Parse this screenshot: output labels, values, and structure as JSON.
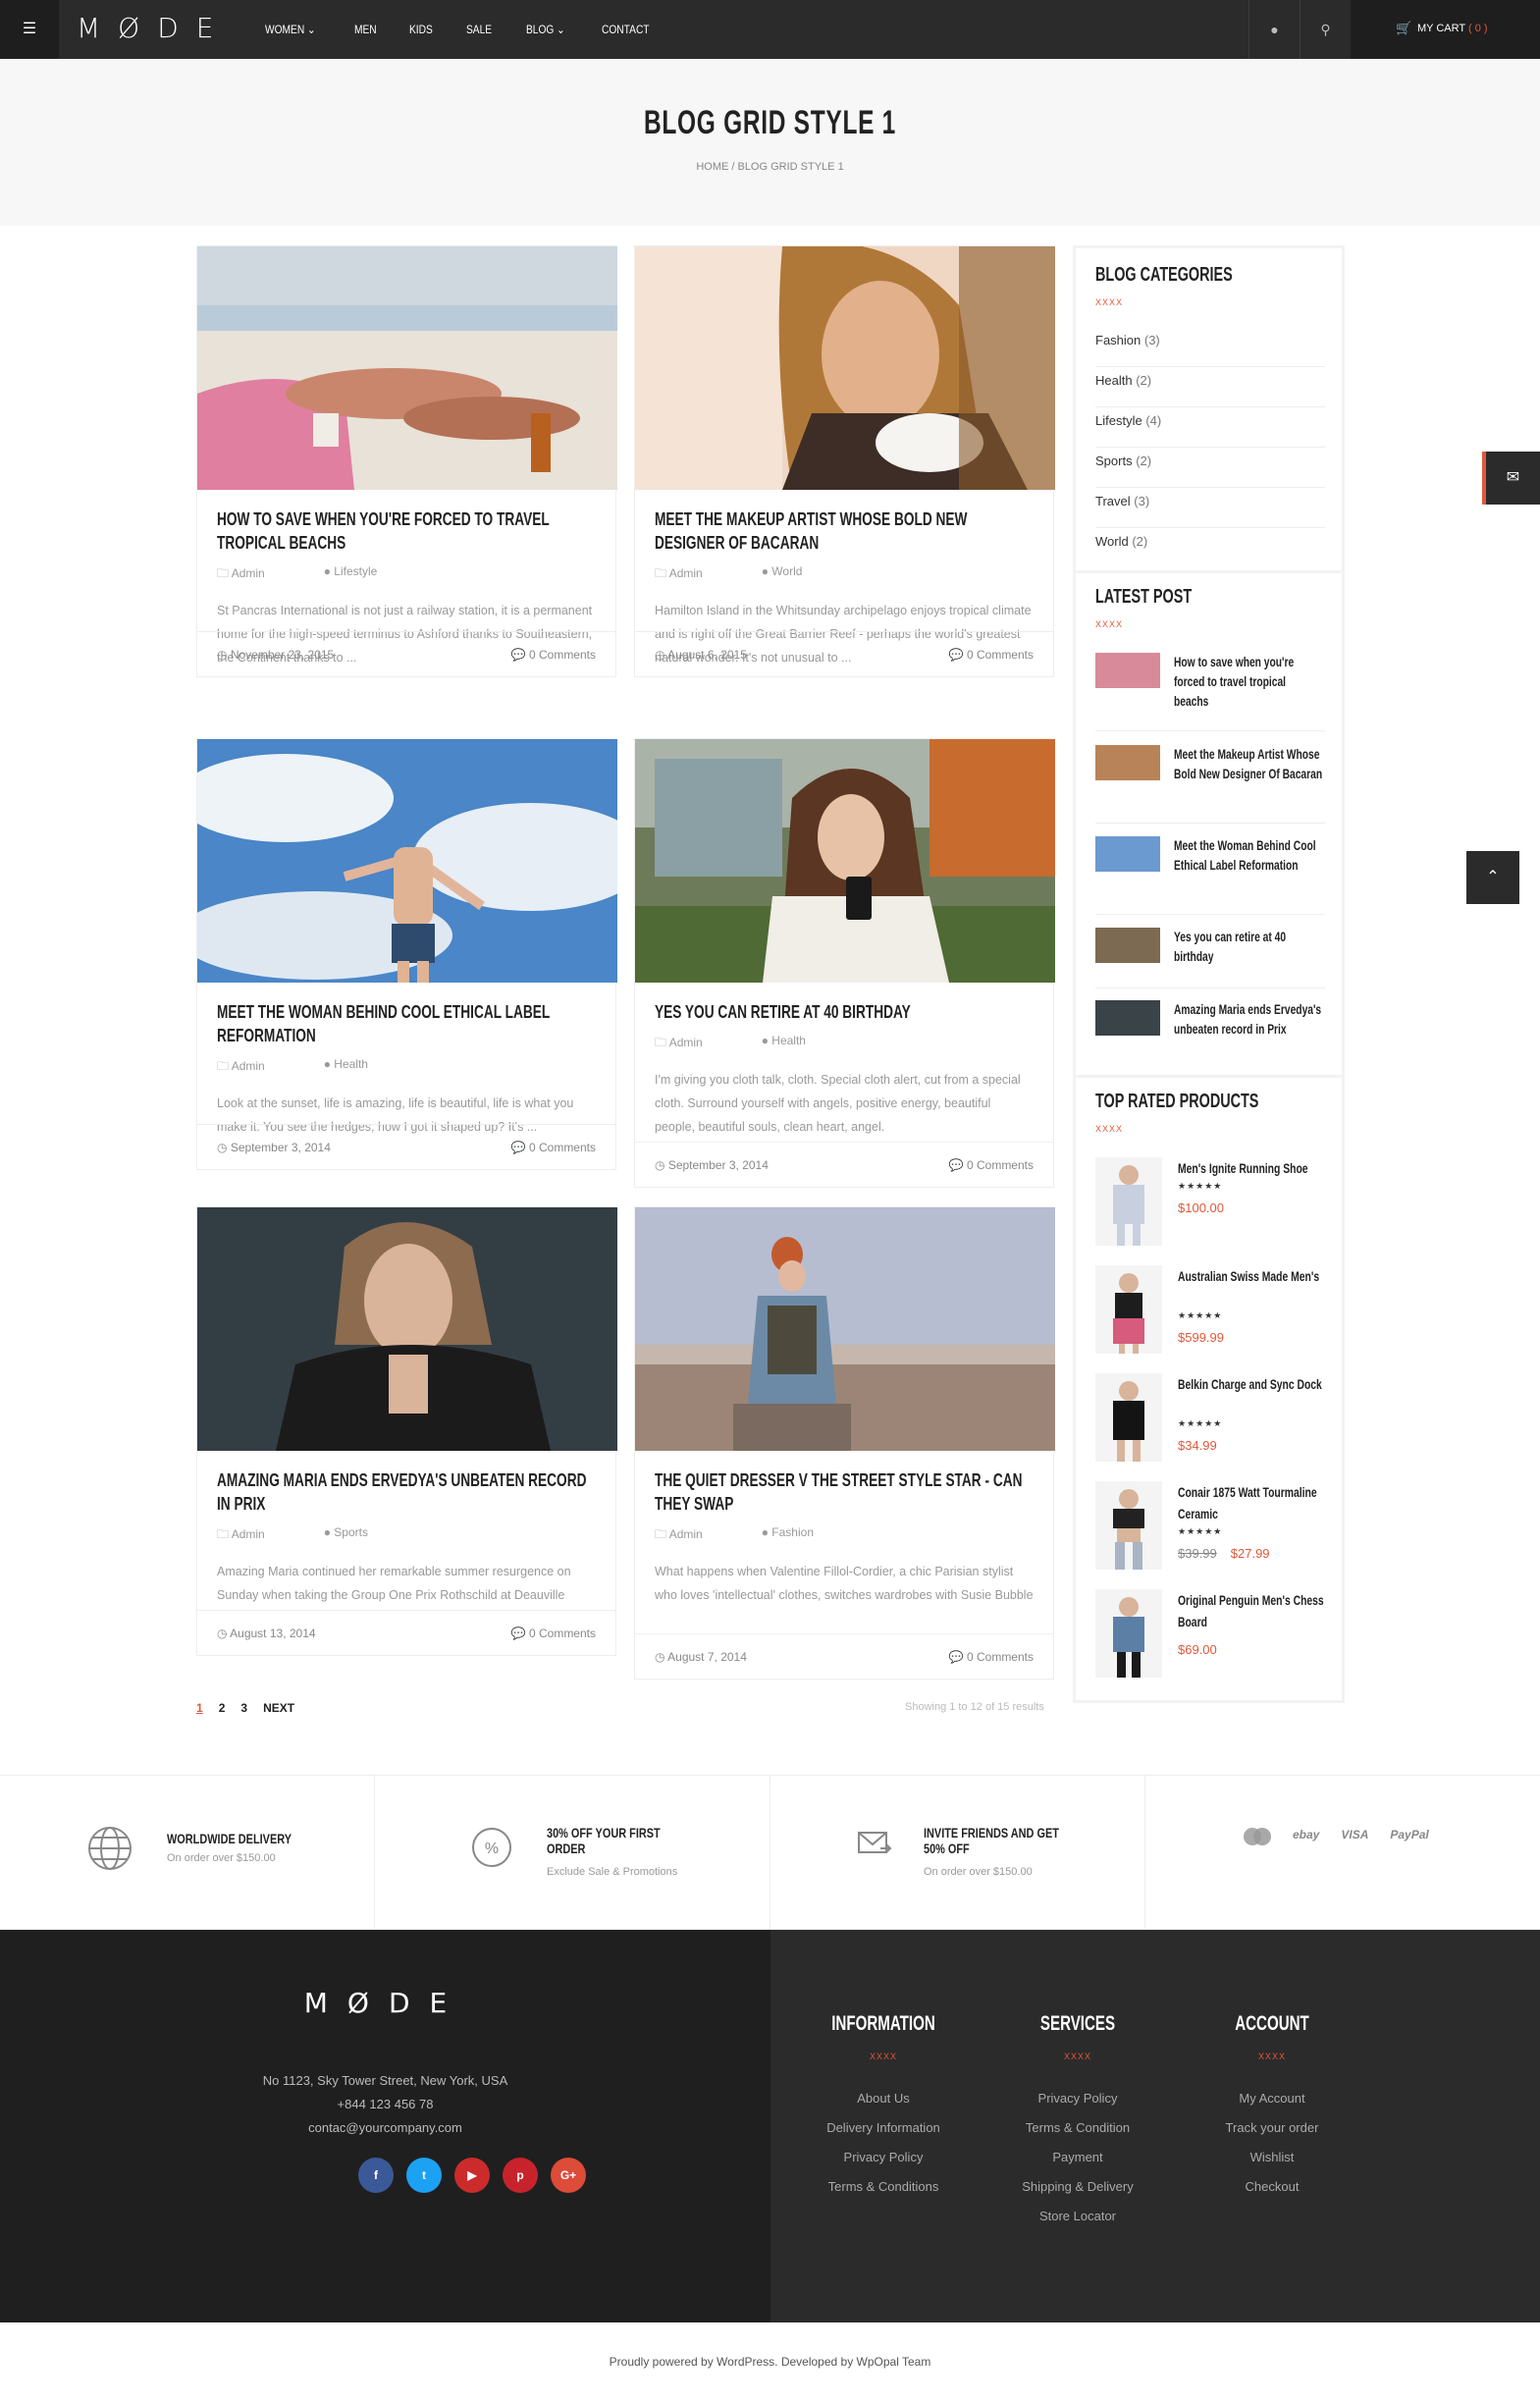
{
  "header": {
    "logo": "MØDE",
    "nav": [
      "WOMEN ⌄",
      "MEN",
      "KIDS",
      "SALE",
      "BLOG ⌄",
      "CONTACT"
    ],
    "cart_label": "MY CART",
    "cart_count": "( 0 )"
  },
  "hero": {
    "title": "BLOG GRID STYLE 1",
    "breadcrumb": "HOME /  BLOG GRID STYLE 1"
  },
  "posts": [
    {
      "title": "HOW TO SAVE WHEN YOU'RE FORCED TO TRAVEL TROPICAL BEACHS",
      "author": "Admin",
      "category": "Lifestyle",
      "excerpt": "St Pancras International is not just a railway station, it is a permanent home for the high-speed terminus to Ashford thanks to Southeastern, the Continent thanks to ...",
      "date": "November 23, 2015",
      "comments": "0  Comments"
    },
    {
      "title": "MEET THE MAKEUP ARTIST WHOSE BOLD NEW DESIGNER OF BACARAN",
      "author": "Admin",
      "category": "World",
      "excerpt": "Hamilton Island in the Whitsunday archipelago enjoys tropical climate and is right off the Great Barrier Reef - perhaps the world's greatest natural wonder. It's not unusual to ...",
      "date": "August 6, 2015",
      "comments": "0  Comments"
    },
    {
      "title": "MEET THE WOMAN BEHIND COOL ETHICAL LABEL REFORMATION",
      "author": "Admin",
      "category": "Health",
      "excerpt": "Look at the sunset, life is amazing, life is beautiful, life is what you make it. You see the hedges, how I got it shaped up? It's ...",
      "date": "September 3, 2014",
      "comments": "0  Comments"
    },
    {
      "title": "YES YOU CAN RETIRE AT 40 BIRTHDAY",
      "author": "Admin",
      "category": "Health",
      "excerpt": "I'm giving you cloth talk, cloth. Special cloth alert, cut from a special cloth. Surround yourself with angels, positive energy, beautiful people, beautiful souls, clean heart, angel.",
      "date": "September 3, 2014",
      "comments": "0  Comments"
    },
    {
      "title": "AMAZING MARIA ENDS ERVEDYA'S UNBEATEN RECORD IN PRIX",
      "author": "Admin",
      "category": "Sports",
      "excerpt": "Amazing Maria continued her remarkable summer resurgence on Sunday when taking the Group One Prix Rothschild at Deauville",
      "date": "August 13, 2014",
      "comments": "0  Comments"
    },
    {
      "title": "THE QUIET DRESSER V THE STREET STYLE STAR - CAN THEY SWAP",
      "author": "Admin",
      "category": "Fashion",
      "excerpt": "What happens when Valentine Fillol-Cordier, a chic Parisian stylist who loves 'intellectual' clothes, switches wardrobes with Susie Bubble",
      "date": "August 7, 2014",
      "comments": "0  Comments"
    }
  ],
  "pagination": {
    "pages": [
      "1",
      "2",
      "3",
      "NEXT"
    ],
    "showing": "Showing 1 to 12 of 15 results"
  },
  "sidebar": {
    "categories_title": "BLOG CATEGORIES",
    "deco": "XXXX",
    "categories": [
      {
        "name": "Fashion",
        "count": "(3)"
      },
      {
        "name": "Health",
        "count": "(2)"
      },
      {
        "name": "Lifestyle",
        "count": "(4)"
      },
      {
        "name": "Sports",
        "count": "(2)"
      },
      {
        "name": "Travel",
        "count": "(3)"
      },
      {
        "name": "World",
        "count": "(2)"
      }
    ],
    "latest_title": "LATEST POST",
    "latest": [
      "How to save when you're forced to travel tropical beachs",
      "Meet the Makeup Artist Whose Bold New Designer Of Bacaran",
      "Meet the Woman Behind Cool Ethical Label Reformation",
      "Yes you can retire at 40 birthday",
      "Amazing Maria ends Ervedya's unbeaten record in Prix"
    ],
    "rated_title": "TOP RATED PRODUCTS",
    "stars": "★★★★★",
    "products": [
      {
        "name": "Men's Ignite Running Shoe",
        "old": "",
        "price": "$100.00"
      },
      {
        "name": "Australian Swiss Made Men's",
        "old": "",
        "price": "$599.99"
      },
      {
        "name": "Belkin Charge and Sync Dock",
        "old": "",
        "price": "$34.99"
      },
      {
        "name": "Conair 1875 Watt Tourmaline Ceramic",
        "old": "$39.99",
        "price": "$27.99"
      },
      {
        "name": "Original Penguin Men's Chess Board",
        "old": "",
        "price": "$69.00"
      }
    ]
  },
  "features": [
    {
      "title": "WORLDWIDE DELIVERY",
      "sub": "On order over $150.00"
    },
    {
      "title": "30% OFF YOUR FIRST ORDER",
      "sub": "Exclude Sale & Promotions"
    },
    {
      "title": "INVITE FRIENDS AND GET 50% OFF",
      "sub": "On order over $150.00"
    }
  ],
  "payments": [
    "ebay",
    "VISA",
    "PayPal"
  ],
  "footer": {
    "logo": "MØDE",
    "address": "No 1123, Sky Tower Street, New York, USA",
    "phone": "+844 123 456 78",
    "email": "contac@yourcompany.com",
    "social": [
      "f",
      "t",
      "▶",
      "p",
      "G+"
    ],
    "columns": [
      {
        "title": "INFORMATION",
        "links": [
          "About Us",
          "Delivery Information",
          "Privacy Policy",
          "Terms & Conditions"
        ]
      },
      {
        "title": "SERVICES",
        "links": [
          "Privacy Policy",
          "Terms & Condition",
          "Payment",
          "Shipping & Delivery",
          "Store Locator"
        ]
      },
      {
        "title": "ACCOUNT",
        "links": [
          "My Account",
          "Track your order",
          "Wishlist",
          "Checkout"
        ]
      }
    ],
    "deco": "XXXX",
    "credit": "Proudly powered by WordPress. Developed by WpOpal Team"
  },
  "colors": {
    "accent": "#e0583a",
    "dark": "#2b2b2b"
  }
}
